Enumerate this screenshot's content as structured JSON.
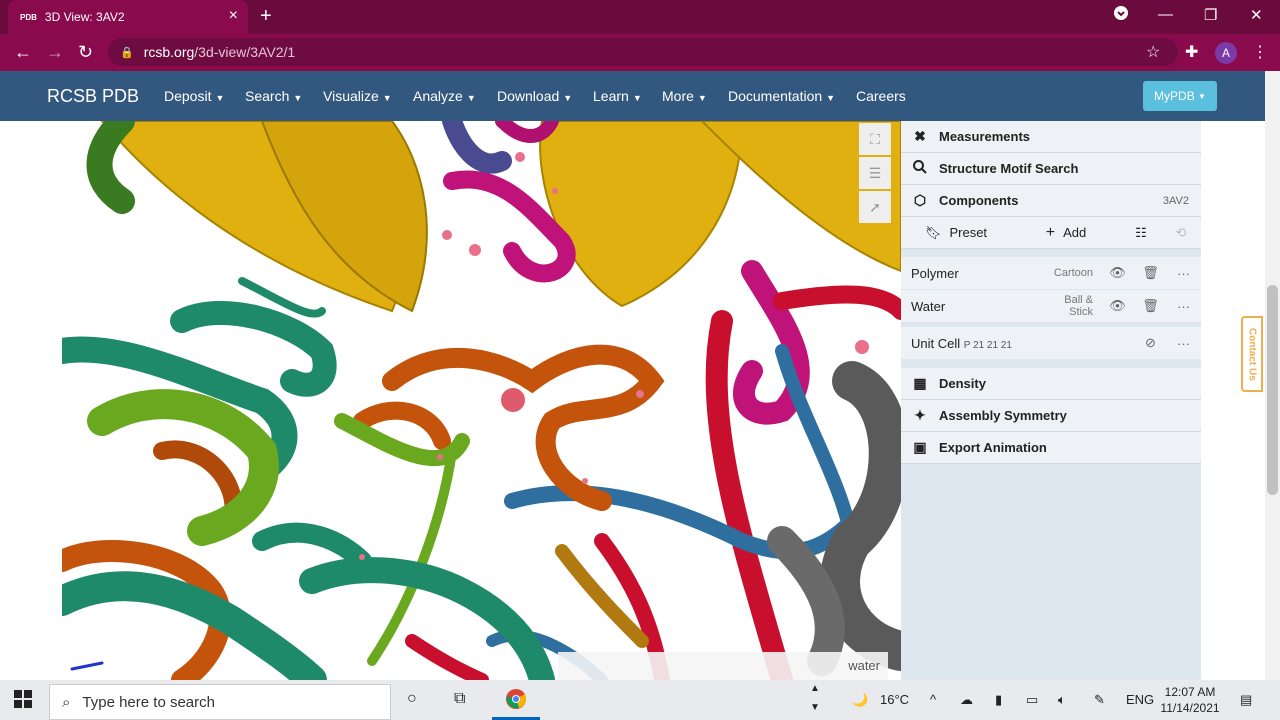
{
  "browser": {
    "tab_title": "3D View: 3AV2",
    "tab_favicon_text": "PDB",
    "url_host": "rcsb.org",
    "url_path": "/3d-view/3AV2/1",
    "profile_initial": "A"
  },
  "site_nav": {
    "brand": "RCSB PDB",
    "items": [
      {
        "label": "Deposit",
        "caret": true
      },
      {
        "label": "Search",
        "caret": true
      },
      {
        "label": "Visualize",
        "caret": true
      },
      {
        "label": "Analyze",
        "caret": true
      },
      {
        "label": "Download",
        "caret": true
      },
      {
        "label": "Learn",
        "caret": true
      },
      {
        "label": "More",
        "caret": true
      },
      {
        "label": "Documentation",
        "caret": true
      },
      {
        "label": "Careers",
        "caret": false
      }
    ],
    "mypdb_label": "MyPDB"
  },
  "viewer": {
    "hover_label": "water"
  },
  "panel": {
    "measurements": "Measurements",
    "structure_motif_search": "Structure Motif Search",
    "components": "Components",
    "components_id": "3AV2",
    "preset_label": "Preset",
    "add_label": "Add",
    "component_rows": [
      {
        "name": "Polymer",
        "representation": "Cartoon",
        "visible": true
      },
      {
        "name": "Water",
        "representation": "Ball & Stick",
        "visible": true
      }
    ],
    "unit_cell": {
      "name": "Unit Cell",
      "space_group": "P 21 21 21",
      "visible": false
    },
    "density": "Density",
    "assembly_symmetry": "Assembly Symmetry",
    "export_animation": "Export Animation"
  },
  "contact_tab": "Contact Us",
  "taskbar": {
    "search_placeholder": "Type here to search",
    "temperature": "16°C",
    "language": "ENG",
    "time": "12:07 AM",
    "date": "11/14/2021"
  },
  "colors": {
    "browser_frame": "#8a0a4e",
    "site_nav": "#325880",
    "mypdb_button": "#5bc0de",
    "contact_tab": "#f0ad4e",
    "helix_yellow": "#e0b010",
    "helix_green": "#1f8a6a",
    "helix_orange": "#c4540c",
    "helix_magenta": "#c0137a",
    "helix_red": "#c8102e",
    "helix_blue": "#2f6fa0",
    "helix_gray": "#5a5a5a"
  }
}
